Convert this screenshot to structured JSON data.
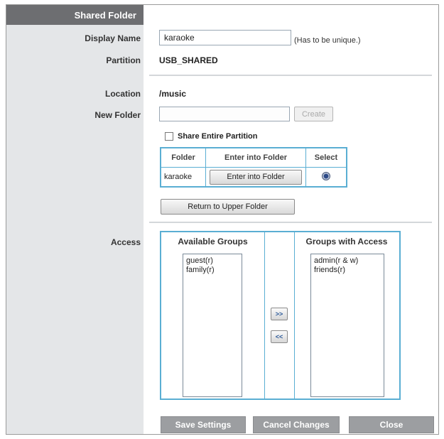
{
  "sidebar": {
    "header": "Shared Folder"
  },
  "labels": {
    "display_name": "Display Name",
    "partition": "Partition",
    "location": "Location",
    "new_folder": "New Folder",
    "access": "Access"
  },
  "display_name": {
    "value": "karaoke",
    "hint": "(Has to be unique.)"
  },
  "partition": {
    "value": "USB_SHARED"
  },
  "location": {
    "value": "/music"
  },
  "new_folder": {
    "value": "",
    "create_label": "Create"
  },
  "share_entire_partition": {
    "label": "Share Entire Partition",
    "checked": false
  },
  "folder_table": {
    "headers": [
      "Folder",
      "Enter into Folder",
      "Select"
    ],
    "rows": [
      {
        "folder": "karaoke",
        "enter_label": "Enter into Folder",
        "selected": true
      }
    ]
  },
  "return_button_label": "Return to Upper Folder",
  "access": {
    "available_header": "Available Groups",
    "with_access_header": "Groups with Access",
    "available": [
      "guest(r)",
      "family(r)"
    ],
    "with_access": [
      "admin(r & w)",
      "friends(r)"
    ],
    "add_label": ">>",
    "remove_label": "<<"
  },
  "footer": {
    "save_label": "Save Settings",
    "cancel_label": "Cancel Changes",
    "close_label": "Close"
  },
  "colors": {
    "sidebar_bg": "#e4e6e8",
    "sidebar_header_bg": "#6d6e71",
    "table_border": "#5aaed3",
    "footer_button_bg": "#9c9ea1"
  }
}
